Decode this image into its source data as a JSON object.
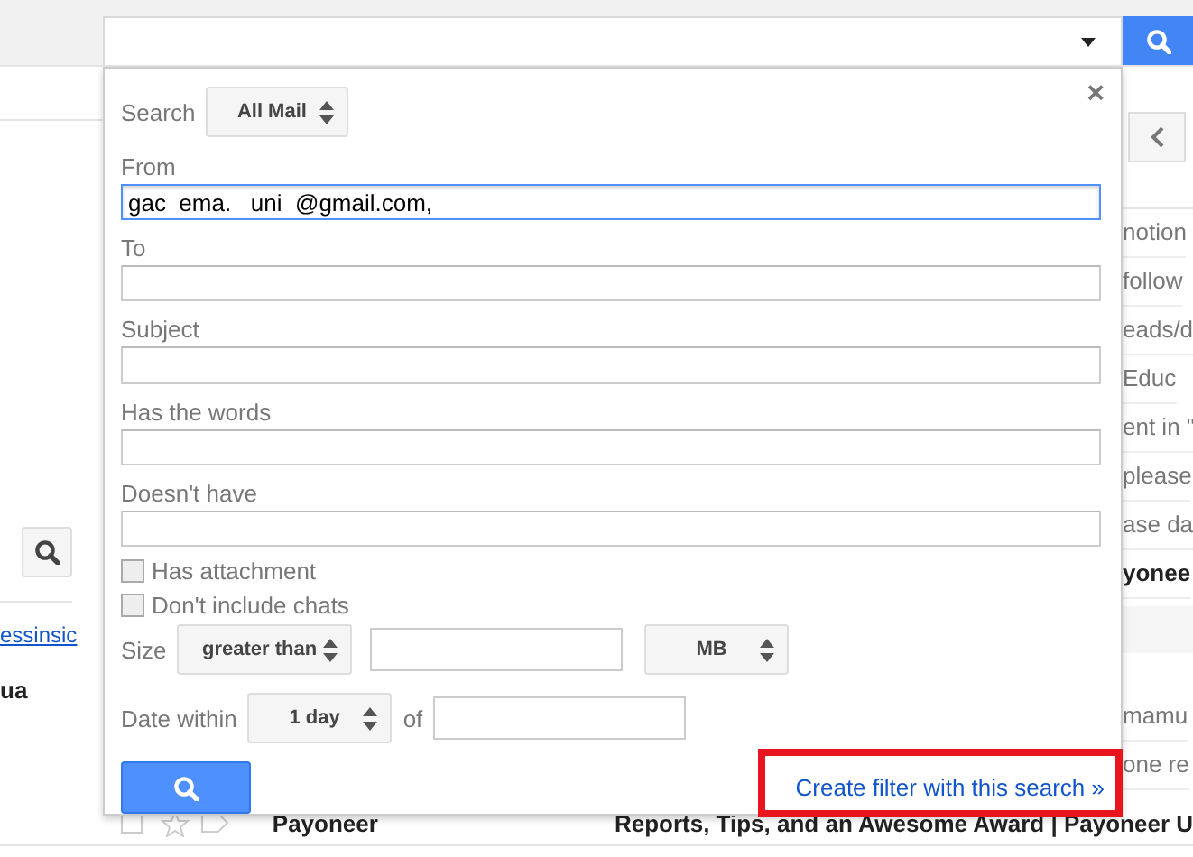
{
  "search_bar": {
    "kind": "empty"
  },
  "background": {
    "left_link": "essinsic",
    "left_bold": "ua",
    "right_snippets": [
      {
        "text": "notion",
        "bold": false
      },
      {
        "text": "follow",
        "bold": false
      },
      {
        "text": "eads/d",
        "bold": false
      },
      {
        "text": "Educ",
        "bold": false
      },
      {
        "text": "ent in \"",
        "bold": false
      },
      {
        "text": "please",
        "bold": false
      },
      {
        "text": "ase da",
        "bold": false
      },
      {
        "text": "yonee",
        "bold": true
      },
      {
        "text": "mamu",
        "bold": false
      },
      {
        "text": "one re",
        "bold": false
      }
    ],
    "bottom_row": {
      "sender": "Payoneer",
      "subject": "Reports, Tips, and an Awesome Award | Payoneer U",
      "checked": false,
      "starred": false
    }
  },
  "popup": {
    "close": "×",
    "search_label": "Search",
    "scope": "All Mail",
    "fields": [
      {
        "label": "From",
        "value": "gac  ema.   uni  @gmail.com,",
        "focused": true
      },
      {
        "label": "To",
        "focused": false
      },
      {
        "label": "Subject",
        "focused": false
      },
      {
        "label": "Has the words",
        "focused": false
      },
      {
        "label": "Doesn't have",
        "focused": false
      }
    ],
    "checkboxes": [
      {
        "label": "Has attachment",
        "checked": false
      },
      {
        "label": "Don't include chats",
        "checked": false
      }
    ],
    "size": {
      "label": "Size",
      "operator": "greater than",
      "unit": "MB"
    },
    "date": {
      "label": "Date within",
      "range": "1 day",
      "of_label": "of"
    },
    "create_filter_link": "Create filter with this search »"
  }
}
